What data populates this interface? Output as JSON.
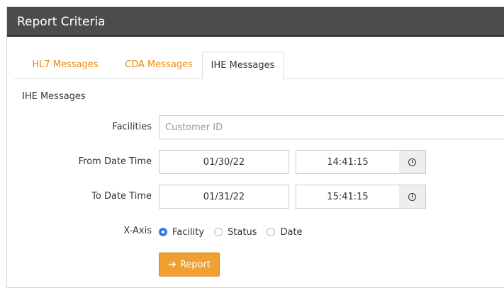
{
  "panel": {
    "title": "Report Criteria"
  },
  "tabs": [
    {
      "label": "HL7 Messages",
      "active": false
    },
    {
      "label": "CDA Messages",
      "active": false
    },
    {
      "label": "IHE Messages",
      "active": true
    }
  ],
  "section": {
    "label": "IHE Messages"
  },
  "form": {
    "facilities": {
      "label": "Facilities",
      "placeholder": "Customer ID",
      "value": ""
    },
    "from": {
      "label": "From Date Time",
      "date": "01/30/22",
      "time": "14:41:15"
    },
    "to": {
      "label": "To Date Time",
      "date": "01/31/22",
      "time": "15:41:15"
    },
    "x_axis": {
      "label": "X-Axis",
      "options": [
        "Facility",
        "Status",
        "Date"
      ],
      "selected": "Facility"
    }
  },
  "actions": {
    "report_label": "Report",
    "report_icon": "arrow-right-icon"
  },
  "icons": {
    "time_addon": "clock-icon"
  },
  "colors": {
    "header_bg": "#4c4c4c",
    "tab_link": "#e8880e",
    "button_bg": "#f0a030",
    "radio_checked": "#2f7de1"
  }
}
